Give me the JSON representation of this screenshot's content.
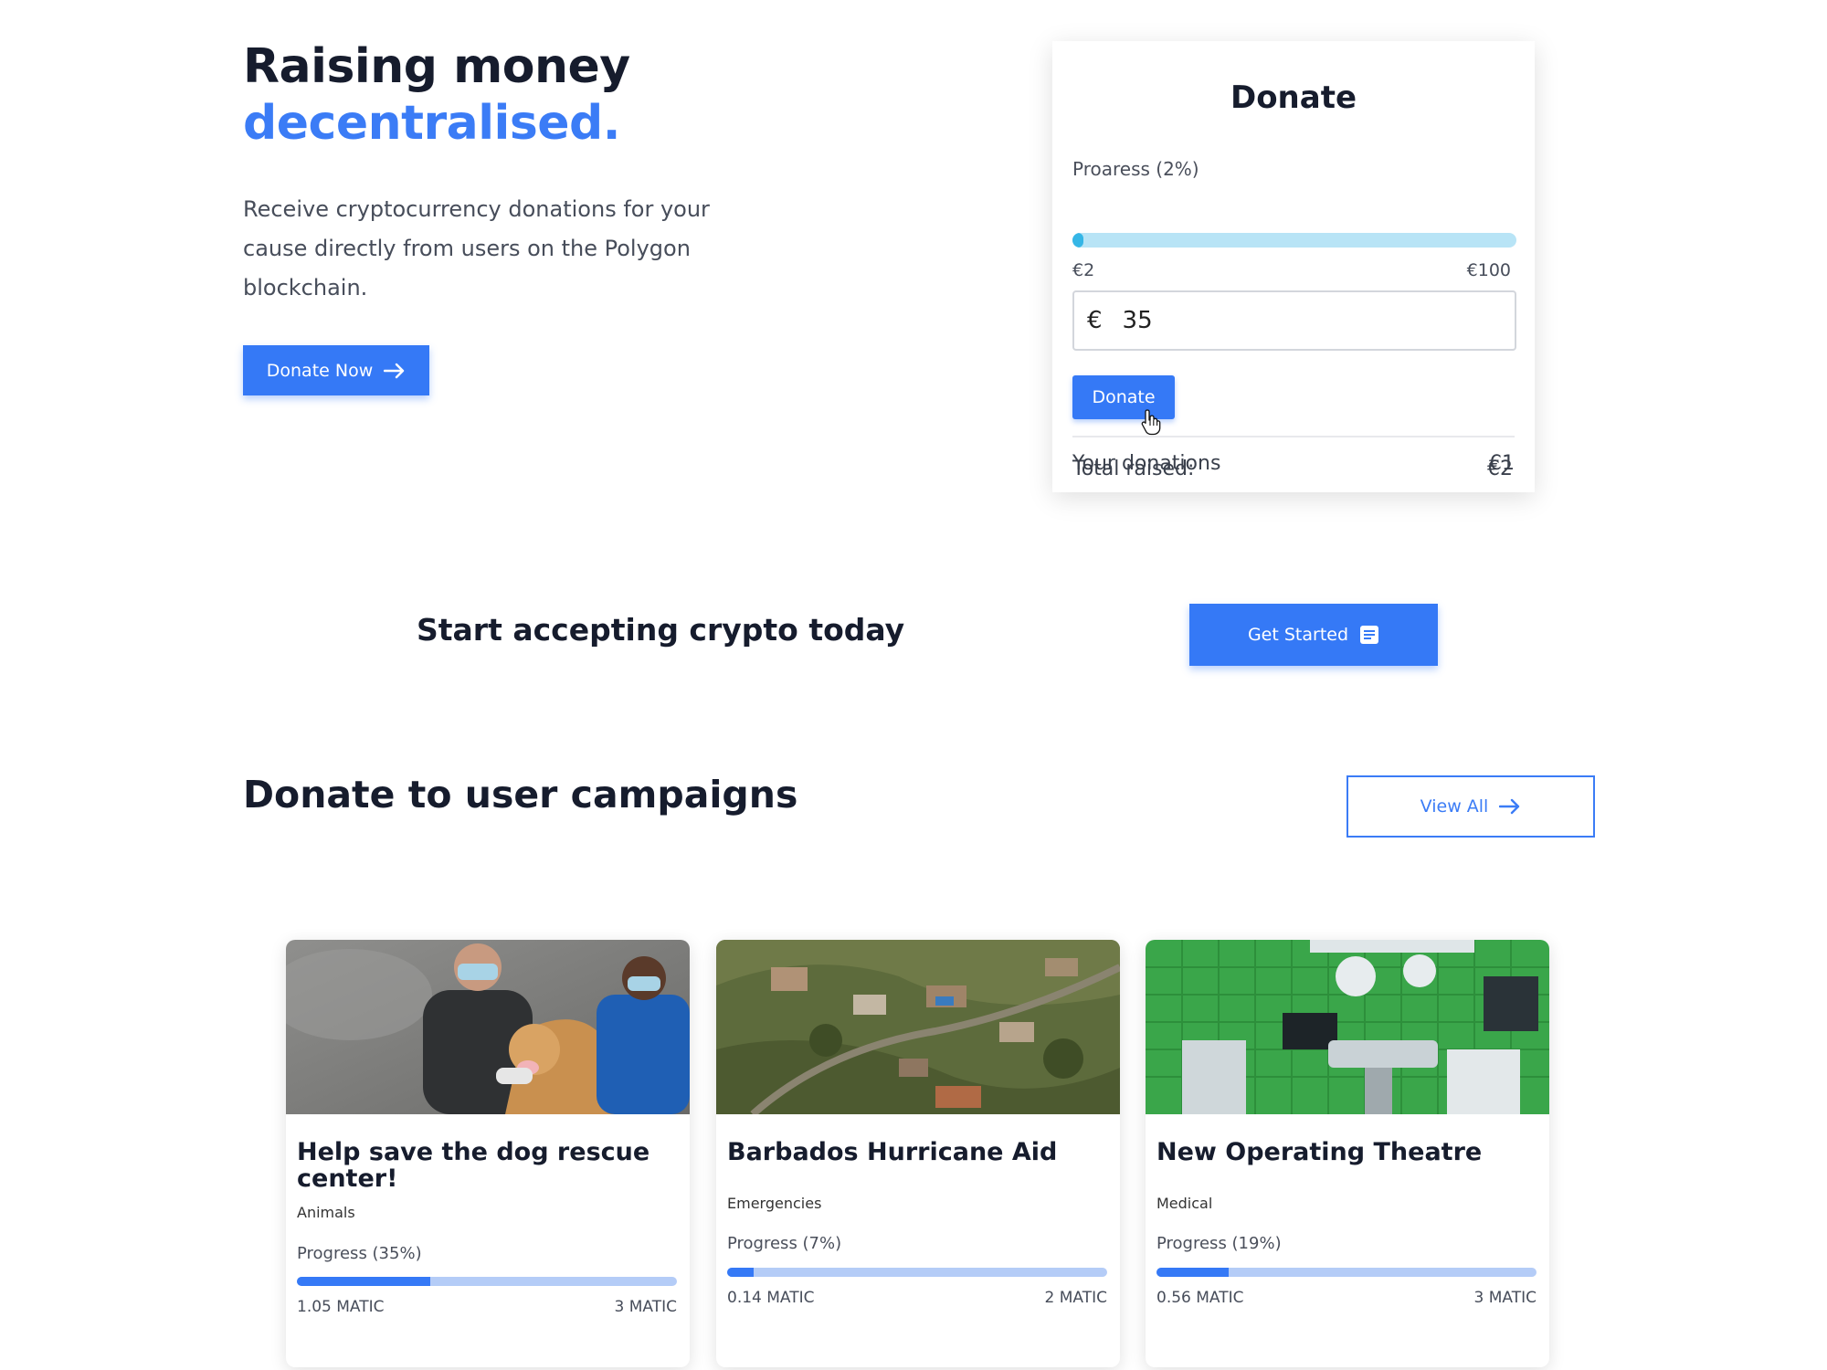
{
  "hero": {
    "title_line1": "Raising money",
    "title_line2": "decentralised.",
    "description": "Receive cryptocurrency donations for your cause directly from users on the Polygon blockchain.",
    "cta_label": "Donate Now",
    "cta_icon": "arrow-right-icon"
  },
  "donate_widget": {
    "title": "Donate",
    "progress_label": "Proaress (2%)",
    "progress_fraction": 0.02,
    "min_label": "€2",
    "max_label": "€100",
    "currency_symbol": "€",
    "amount_value": "35",
    "button_label": "Donate",
    "total_raised_label": "Total raised:",
    "total_raised_value": "€2",
    "your_donations_label": "Your donations",
    "your_donations_value": "€1"
  },
  "cta_band": {
    "text": "Start accepting crypto today",
    "button_label": "Get Started",
    "button_icon": "document-icon"
  },
  "campaigns_section": {
    "title": "Donate to user campaigns",
    "view_all_label": "View All",
    "view_all_icon": "arrow-right-icon"
  },
  "campaigns": [
    {
      "title": "Help save the dog rescue center!",
      "category": "Animals",
      "progress_label": "Progress (35%)",
      "progress_fraction": 0.35,
      "raised": "1.05 MATIC",
      "goal": "3 MATIC",
      "image": "vet-with-dog-photo"
    },
    {
      "title": "Barbados Hurricane Aid",
      "category": "Emergencies",
      "progress_label": "Progress (7%)",
      "progress_fraction": 0.07,
      "raised": "0.14 MATIC",
      "goal": "2 MATIC",
      "image": "hurricane-damage-aerial-photo"
    },
    {
      "title": "New Operating Theatre",
      "category": "Medical",
      "progress_label": "Progress (19%)",
      "progress_fraction": 0.19,
      "raised": "0.56 MATIC",
      "goal": "3 MATIC",
      "image": "operating-theatre-photo"
    }
  ],
  "colors": {
    "accent": "#3b7cf6",
    "heading": "#161c2d",
    "widget_progress": "#35b6e6",
    "widget_progress_track": "#b8e4f6",
    "card_progress": "#3579f6",
    "card_progress_track": "#b4ccf7"
  }
}
